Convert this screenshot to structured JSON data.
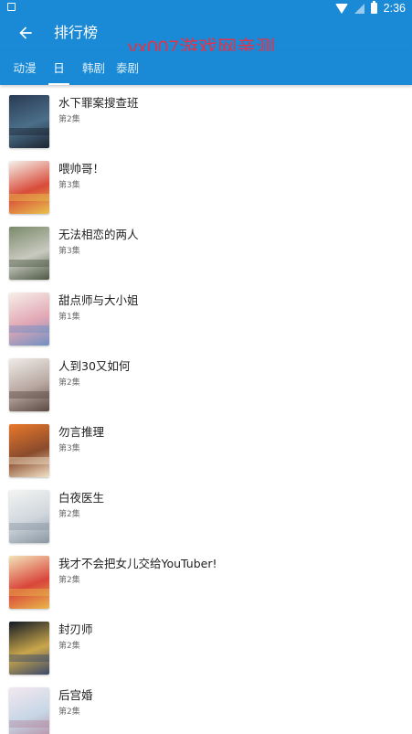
{
  "status_bar": {
    "time": "2:36"
  },
  "app_bar": {
    "title": "排行榜",
    "watermark": "yx007游戏网亲测"
  },
  "tabs": [
    {
      "label": "动漫",
      "active": false
    },
    {
      "label": "日剧",
      "active": true
    },
    {
      "label": "韩剧",
      "active": false
    },
    {
      "label": "泰剧",
      "active": false
    }
  ],
  "list": [
    {
      "title": "水下罪案搜查班",
      "episode": "第2集",
      "poster_colors": [
        "#2a3a52",
        "#4b6f8a",
        "#1c2430"
      ]
    },
    {
      "title": "喂帅哥！",
      "episode": "第3集",
      "poster_colors": [
        "#f4f1ea",
        "#d94b3a",
        "#e8c34c"
      ]
    },
    {
      "title": "无法相恋的两人",
      "episode": "第3集",
      "poster_colors": [
        "#7a8a6a",
        "#c9c9c0",
        "#4d5a44"
      ]
    },
    {
      "title": "甜点师与大小姐",
      "episode": "第1集",
      "poster_colors": [
        "#f6efe9",
        "#e2a7b4",
        "#6f8fc4"
      ]
    },
    {
      "title": "人到30又如何",
      "episode": "第2集",
      "poster_colors": [
        "#efece8",
        "#b8a7a0",
        "#5b4a44"
      ]
    },
    {
      "title": "勿言推理",
      "episode": "第3集",
      "poster_colors": [
        "#e9782a",
        "#8a4b2c",
        "#f2e2c8"
      ]
    },
    {
      "title": "白夜医生",
      "episode": "第2集",
      "poster_colors": [
        "#f4f4f2",
        "#cfd6dc",
        "#8a97a3"
      ]
    },
    {
      "title": "我才不会把女儿交给YouTuber!",
      "episode": "第2集",
      "poster_colors": [
        "#f3e3b8",
        "#d9453a",
        "#e9b74a"
      ]
    },
    {
      "title": "封刃师",
      "episode": "第2集",
      "poster_colors": [
        "#121a26",
        "#c9a64a",
        "#3a4a6a"
      ]
    },
    {
      "title": "后宫婚",
      "episode": "第2集",
      "poster_colors": [
        "#f2e8ef",
        "#c7d6e6",
        "#b48aa0"
      ]
    }
  ]
}
